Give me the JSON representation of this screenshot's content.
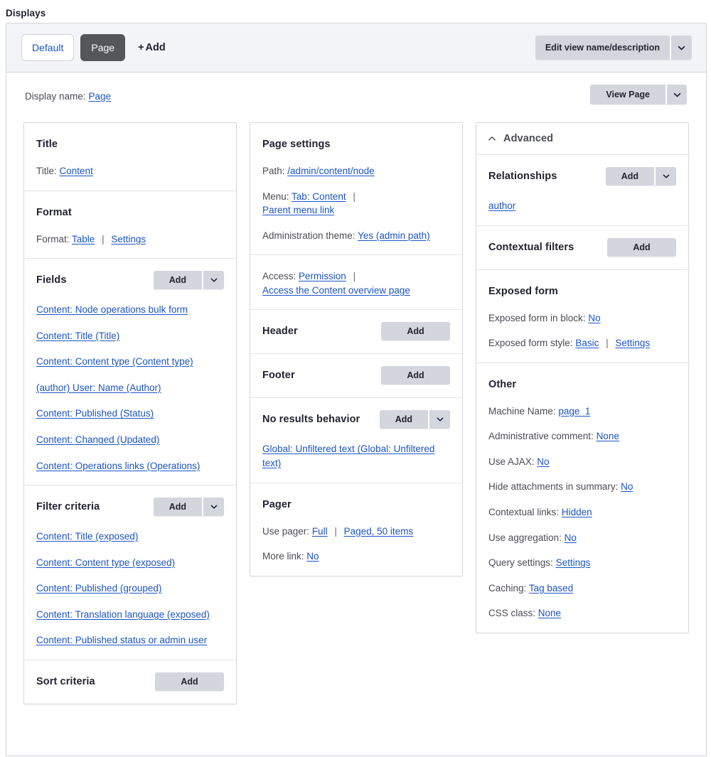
{
  "heading": "Displays",
  "tabs": {
    "items": [
      {
        "label": "Default",
        "active": false
      },
      {
        "label": "Page",
        "active": true
      }
    ],
    "add_label": "Add",
    "add_plus": "+"
  },
  "toolbar": {
    "edit_view_label": "Edit view name/description"
  },
  "display_name": {
    "label": "Display name:",
    "value": "Page"
  },
  "view_page_button": {
    "label": "View Page"
  },
  "common": {
    "add_label": "Add",
    "separator": "|"
  },
  "col1": {
    "title_bucket": {
      "heading": "Title",
      "label": "Title:",
      "value": "Content"
    },
    "format_bucket": {
      "heading": "Format",
      "label": "Format:",
      "value": "Table",
      "settings": "Settings"
    },
    "fields_bucket": {
      "heading": "Fields",
      "add_label": "Add",
      "items": [
        "Content: Node operations bulk form",
        "Content: Title (Title)",
        "Content: Content type (Content type)",
        "(author) User: Name (Author)",
        "Content: Published (Status)",
        "Content: Changed (Updated)",
        "Content: Operations links (Operations)"
      ]
    },
    "filter_bucket": {
      "heading": "Filter criteria",
      "add_label": "Add",
      "items": [
        "Content: Title (exposed)",
        "Content: Content type (exposed)",
        "Content: Published (grouped)",
        "Content: Translation language (exposed)",
        "Content: Published status or admin user"
      ]
    },
    "sort_bucket": {
      "heading": "Sort criteria",
      "add_label": "Add"
    }
  },
  "col2": {
    "page_settings": {
      "heading": "Page settings",
      "path_label": "Path:",
      "path_value": "/admin/content/node",
      "menu_label": "Menu:",
      "menu_value": "Tab: Content",
      "menu_parent": "Parent menu link",
      "admin_theme_label": "Administration theme:",
      "admin_theme_value": "Yes (admin path)"
    },
    "access": {
      "label": "Access:",
      "value": "Permission",
      "detail": "Access the Content overview page"
    },
    "header_bucket": {
      "heading": "Header",
      "add_label": "Add"
    },
    "footer_bucket": {
      "heading": "Footer",
      "add_label": "Add"
    },
    "no_results_bucket": {
      "heading": "No results behavior",
      "add_label": "Add",
      "items": [
        "Global: Unfiltered text (Global: Unfiltered text)"
      ]
    },
    "pager_bucket": {
      "heading": "Pager",
      "use_pager_label": "Use pager:",
      "use_pager_value": "Full",
      "use_pager_detail": "Paged, 50 items",
      "more_link_label": "More link:",
      "more_link_value": "No"
    }
  },
  "col3": {
    "advanced": {
      "heading": "Advanced",
      "caret": "chevron-up"
    },
    "relationships": {
      "heading": "Relationships",
      "add_label": "Add",
      "items": [
        "author"
      ]
    },
    "contextual_filters": {
      "heading": "Contextual filters",
      "add_label": "Add"
    },
    "exposed_form": {
      "heading": "Exposed form",
      "in_block_label": "Exposed form in block:",
      "in_block_value": "No",
      "style_label": "Exposed form style:",
      "style_value": "Basic",
      "style_settings": "Settings"
    },
    "other": {
      "heading": "Other",
      "rows": [
        {
          "label": "Machine Name:",
          "value": "page_1"
        },
        {
          "label": "Administrative comment:",
          "value": "None"
        },
        {
          "label": "Use AJAX:",
          "value": "No"
        },
        {
          "label": "Hide attachments in summary:",
          "value": "No"
        },
        {
          "label": "Contextual links:",
          "value": "Hidden"
        },
        {
          "label": "Use aggregation:",
          "value": "No"
        },
        {
          "label": "Query settings:",
          "value": "Settings"
        },
        {
          "label": "Caching:",
          "value": "Tag based"
        },
        {
          "label": "CSS class:",
          "value": "None"
        }
      ]
    }
  },
  "colors": {
    "link": "#1b54c8",
    "active_tab_bg": "#55565a",
    "button_bg": "#d4d6dd",
    "tabbar_bg": "#f3f4f7",
    "text": "#222330",
    "muted_text": "#4b4c55"
  }
}
